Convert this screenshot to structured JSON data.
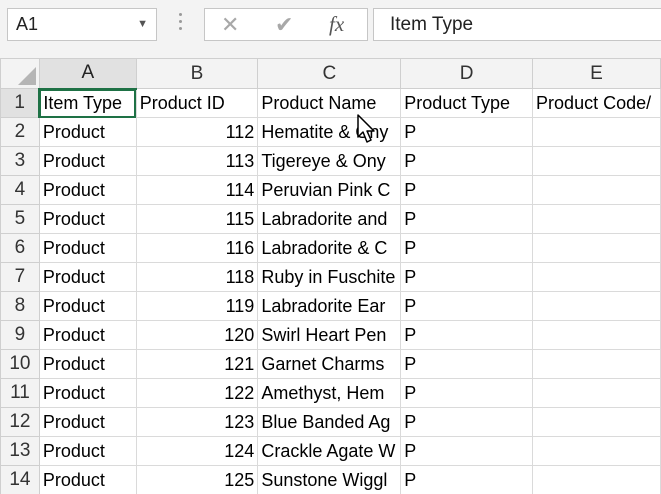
{
  "formula_bar": {
    "name_box": "A1",
    "cancel_icon": "✕",
    "enter_icon": "✔",
    "fx_label": "fx",
    "content": "Item Type"
  },
  "columns": [
    "A",
    "B",
    "C",
    "D",
    "E"
  ],
  "rows": [
    {
      "num": "1",
      "a": "Item Type",
      "b": "Product ID",
      "c": "Product Name",
      "d": "Product Type",
      "e": "Product Code/"
    },
    {
      "num": "2",
      "a": "Product",
      "b": "112",
      "c": "Hematite & Ony",
      "d": "P",
      "e": ""
    },
    {
      "num": "3",
      "a": "Product",
      "b": "113",
      "c": "Tigereye & Ony",
      "d": "P",
      "e": ""
    },
    {
      "num": "4",
      "a": "Product",
      "b": "114",
      "c": "Peruvian Pink C",
      "d": "P",
      "e": ""
    },
    {
      "num": "5",
      "a": "Product",
      "b": "115",
      "c": "Labradorite and",
      "d": "P",
      "e": ""
    },
    {
      "num": "6",
      "a": "Product",
      "b": "116",
      "c": "Labradorite & C",
      "d": "P",
      "e": ""
    },
    {
      "num": "7",
      "a": "Product",
      "b": "118",
      "c": "Ruby in Fuschite",
      "d": "P",
      "e": ""
    },
    {
      "num": "8",
      "a": "Product",
      "b": "119",
      "c": "Labradorite Ear",
      "d": "P",
      "e": ""
    },
    {
      "num": "9",
      "a": "Product",
      "b": "120",
      "c": "Swirl Heart Pen",
      "d": "P",
      "e": ""
    },
    {
      "num": "10",
      "a": "Product",
      "b": "121",
      "c": " Garnet Charms",
      "d": "P",
      "e": ""
    },
    {
      "num": "11",
      "a": "Product",
      "b": "122",
      "c": "Amethyst, Hem",
      "d": "P",
      "e": ""
    },
    {
      "num": "12",
      "a": "Product",
      "b": "123",
      "c": "Blue Banded Ag",
      "d": "P",
      "e": ""
    },
    {
      "num": "13",
      "a": "Product",
      "b": "124",
      "c": "Crackle Agate W",
      "d": "P",
      "e": ""
    },
    {
      "num": "14",
      "a": "Product",
      "b": "125",
      "c": "Sunstone Wiggl",
      "d": "P",
      "e": ""
    }
  ],
  "colors": {
    "accent": "#1e7145",
    "header_bg": "#f3f3f3",
    "gridline": "#dadada"
  }
}
